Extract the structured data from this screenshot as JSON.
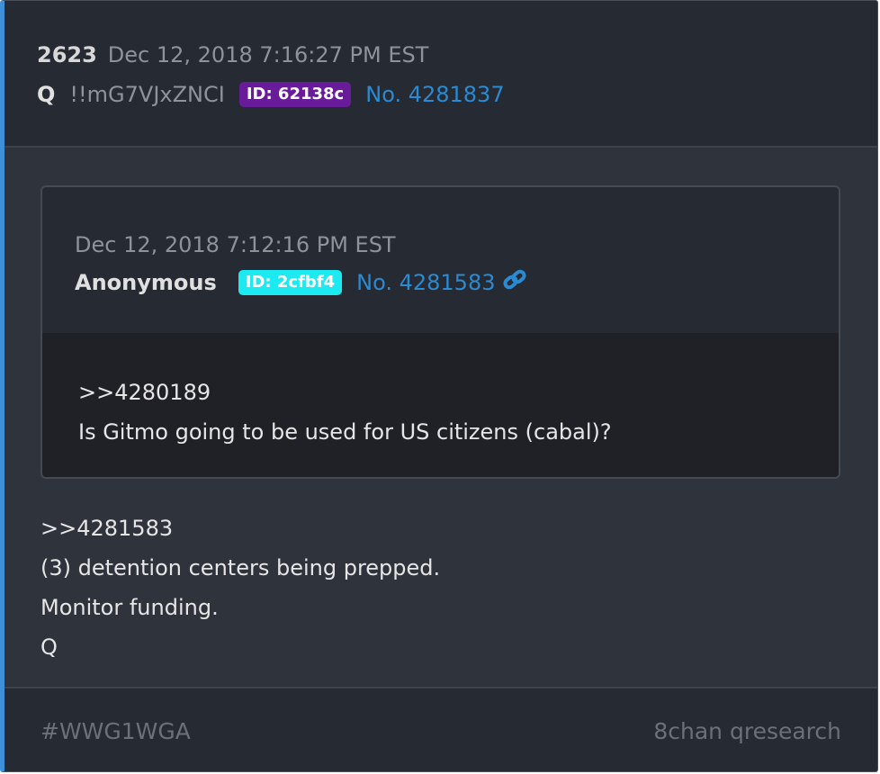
{
  "post": {
    "number": "2623",
    "time": "Dec 12, 2018 7:16:27 PM EST",
    "name": "Q",
    "tripcode": "!!mG7VJxZNCI",
    "id_label": "ID: 62138c",
    "post_no": "No. 4281837"
  },
  "quote": {
    "time": "Dec 12, 2018 7:12:16 PM EST",
    "name": "Anonymous",
    "id_label": "ID: 2cfbf4",
    "post_no": "No. 4281583",
    "lines": [
      ">>4280189",
      "Is Gitmo going to be used for US citizens (cabal)?"
    ]
  },
  "message": {
    "lines": [
      ">>4281583",
      "(3) detention centers being prepped.",
      "Monitor funding.",
      "Q"
    ]
  },
  "footer": {
    "tag": "#WWG1WGA",
    "source": "8chan qresearch"
  },
  "colors": {
    "accent": "#3c8fd8",
    "link": "#2a8ad2",
    "q_id_badge": "#6a1b9a",
    "anon_id_badge": "#1de9f0"
  },
  "icons": [
    "link-chain-icon"
  ]
}
